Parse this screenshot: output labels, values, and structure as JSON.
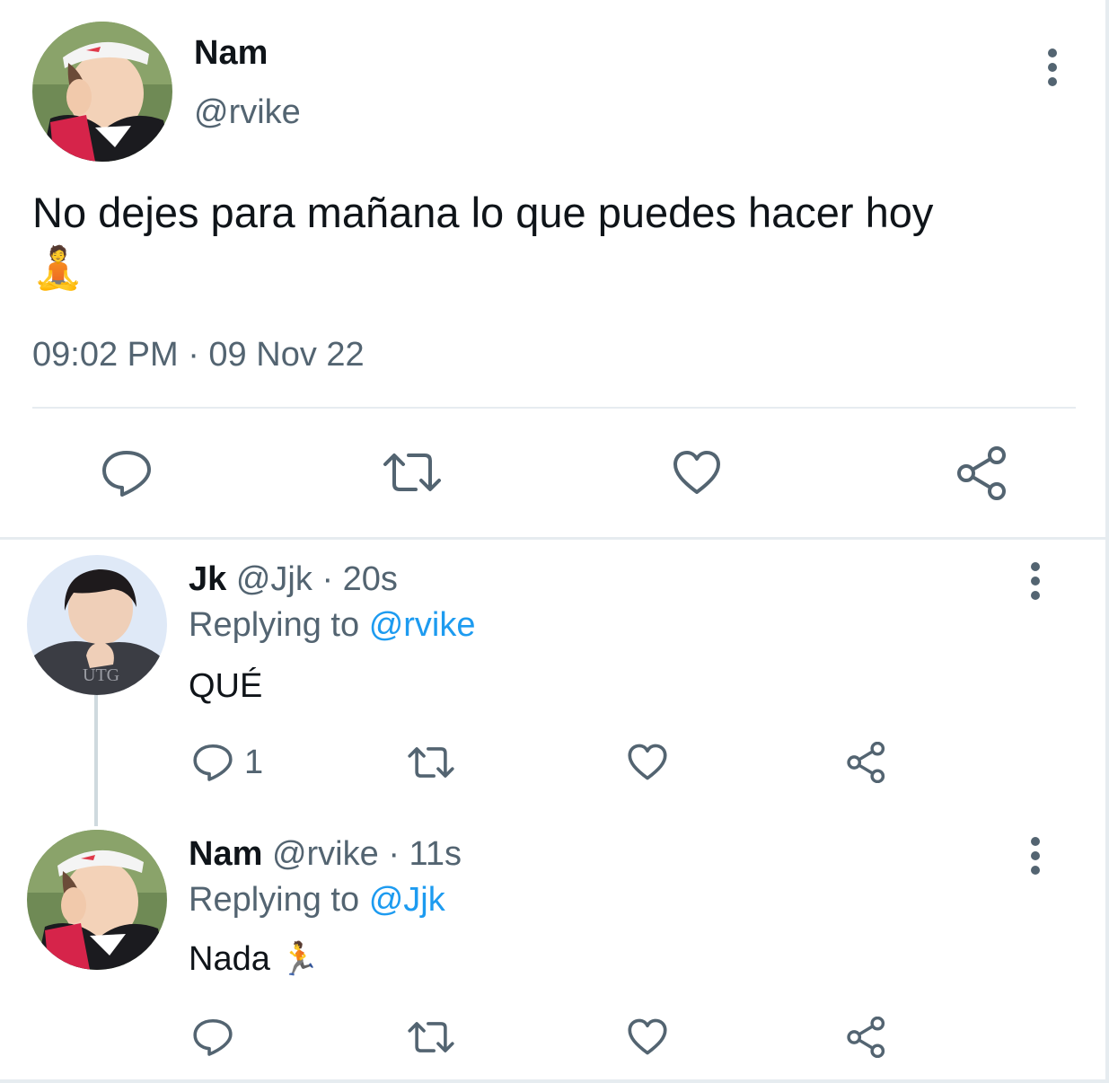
{
  "main_tweet": {
    "author_name": "Nam",
    "author_handle": "@rvike",
    "text": "No dejes para mañana lo que puedes hacer hoy",
    "emoji": "🧘",
    "timestamp": "09:02 PM · 09 Nov 22",
    "actions": {
      "reply_icon": "reply-icon",
      "retweet_icon": "retweet-icon",
      "like_icon": "heart-icon",
      "share_icon": "share-icon"
    }
  },
  "replies": [
    {
      "author_name": "Jk",
      "author_handle": "@Jjk",
      "separator": "·",
      "time_ago": "20s",
      "replying_prefix": "Replying to",
      "replying_to": "@rvike",
      "text": "QUÉ",
      "emoji": "",
      "reply_count": "1"
    },
    {
      "author_name": "Nam",
      "author_handle": "@rvike",
      "separator": "·",
      "time_ago": "11s",
      "replying_prefix": "Replying to",
      "replying_to": "@Jjk",
      "text": "Nada",
      "emoji": "🏃",
      "reply_count": ""
    }
  ],
  "colors": {
    "text_primary": "#0f1419",
    "text_secondary": "#536471",
    "link": "#1d9bf0",
    "divider": "#e6ecf0"
  }
}
